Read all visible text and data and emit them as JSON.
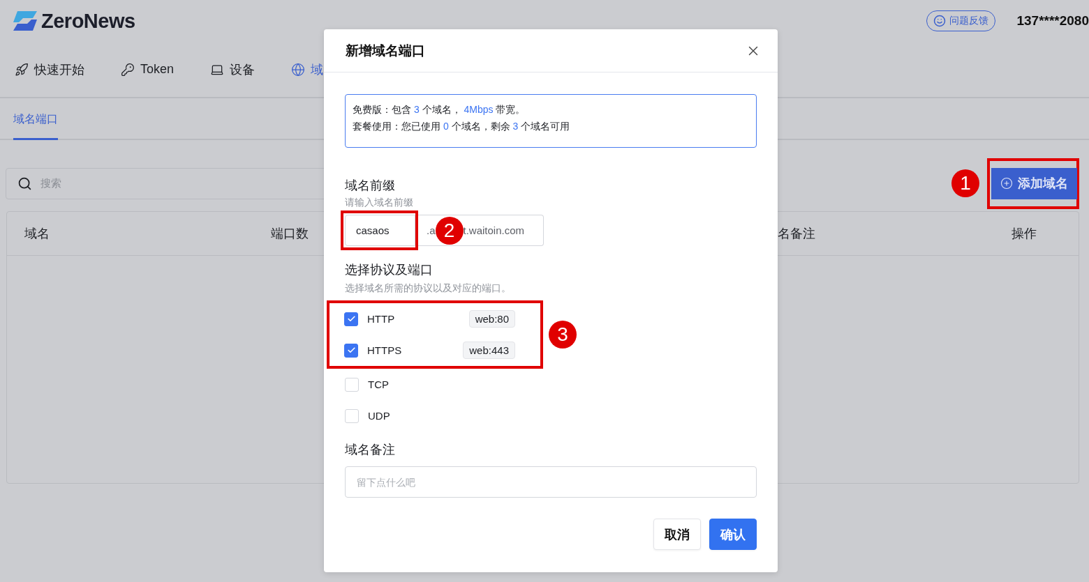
{
  "app": {
    "name": "ZeroNews",
    "feedback": "问题反馈",
    "account": "137****2080"
  },
  "nav": [
    {
      "label": "快速开始",
      "selected": false
    },
    {
      "label": "Token",
      "selected": false
    },
    {
      "label": "设备",
      "selected": false
    },
    {
      "label": "域",
      "selected": true
    }
  ],
  "subtabs": [
    {
      "label": "域名端口",
      "selected": true
    }
  ],
  "search": {
    "placeholder": "搜索"
  },
  "add_button": {
    "label": "添加域名",
    "callout": "1"
  },
  "table": {
    "columns": [
      "域名",
      "端口数",
      "名备注",
      "操作"
    ]
  },
  "dialog": {
    "title": "新增域名端口",
    "info": [
      [
        {
          "kind": "text",
          "text": "免费版：包含 "
        },
        {
          "kind": "value",
          "text": "3"
        },
        {
          "kind": "text",
          "text": " 个域名， "
        },
        {
          "kind": "value",
          "text": "4Mbps"
        },
        {
          "kind": "text",
          "text": " 带宽。"
        }
      ],
      [
        {
          "kind": "text",
          "text": "套餐使用：您已使用 "
        },
        {
          "kind": "value",
          "text": "0"
        },
        {
          "kind": "text",
          "text": " 个域名，剩余 "
        },
        {
          "kind": "value",
          "text": "3"
        },
        {
          "kind": "text",
          "text": " 个域名可用"
        }
      ]
    ],
    "prefix": {
      "label": "域名前缀",
      "hint": "请输入域名前缀",
      "value": "casaos",
      "suffix_start": ".a",
      "suffix_end": "t.waitoin.com",
      "callout": "2"
    },
    "protocols": {
      "label": "选择协议及端口",
      "hint": "选择域名所需的协议以及对应的端口。",
      "callout": "3",
      "items": [
        {
          "name": "HTTP",
          "checked": true,
          "port": "web:80"
        },
        {
          "name": "HTTPS",
          "checked": true,
          "port": "web:443"
        },
        {
          "name": "TCP",
          "checked": false
        },
        {
          "name": "UDP",
          "checked": false
        }
      ]
    },
    "note": {
      "label": "域名备注",
      "placeholder": "留下点什么吧"
    },
    "buttons": [
      {
        "label": "取消",
        "kind": "secondary"
      },
      {
        "label": "确认",
        "kind": "primary"
      }
    ]
  }
}
